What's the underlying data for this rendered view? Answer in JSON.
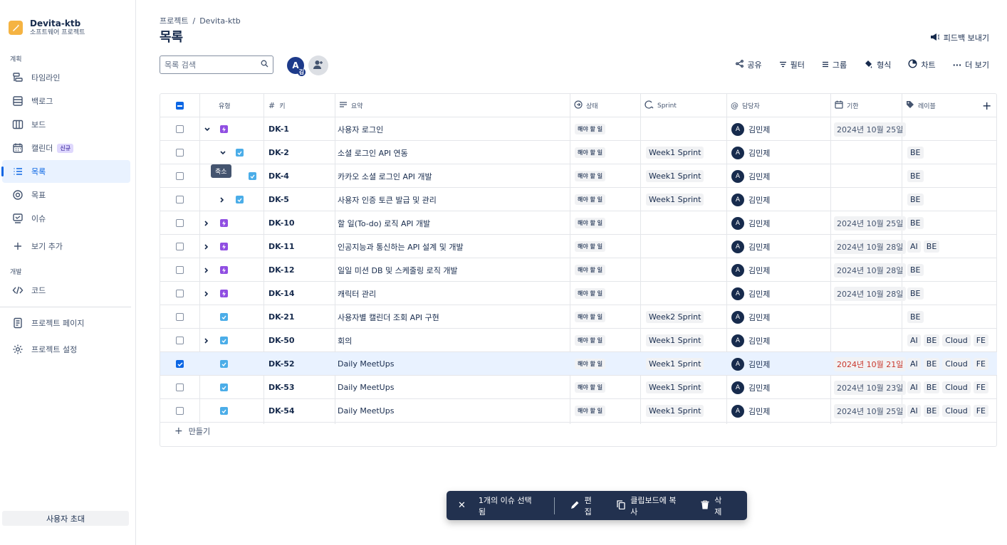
{
  "sidebar": {
    "project_name": "Devita-ktb",
    "project_type": "소프트웨어 프로젝트",
    "section_plan": "계획",
    "items": [
      {
        "label": "타임라인",
        "icon": "timeline-icon"
      },
      {
        "label": "백로그",
        "icon": "backlog-icon"
      },
      {
        "label": "보드",
        "icon": "board-icon"
      },
      {
        "label": "캘린더",
        "icon": "calendar-icon",
        "badge": "신규"
      },
      {
        "label": "목록",
        "icon": "list-icon",
        "active": true
      },
      {
        "label": "목표",
        "icon": "goal-icon"
      },
      {
        "label": "이슈",
        "icon": "issues-icon"
      },
      {
        "label": "보기 추가",
        "icon": "plus-icon"
      }
    ],
    "section_dev": "개발",
    "code": "코드",
    "project_page": "프로젝트 페이지",
    "project_settings": "프로젝트 설정",
    "invite": "사용자 초대"
  },
  "header": {
    "breadcrumb_root": "프로젝트",
    "breadcrumb_sep": "/",
    "breadcrumb_project": "Devita-ktb",
    "title": "목록",
    "feedback": "피드백 보내기",
    "search_placeholder": "목록 검색",
    "avatar_letter": "A",
    "avatar_sub": "김"
  },
  "toolbar": {
    "share": "공유",
    "filter": "필터",
    "group": "그룹",
    "format": "형식",
    "chart": "차트",
    "more": "더 보기"
  },
  "columns": {
    "type": "유형",
    "key": "키",
    "summary": "요약",
    "status": "상태",
    "sprint": "Sprint",
    "assignee": "담당자",
    "due": "기한",
    "labels": "레이블"
  },
  "tooltip": "축소",
  "rows": [
    {
      "checked": false,
      "expand": "v",
      "type": "epic",
      "indent": 0,
      "key": "DK-1",
      "summary": "사용자 로그인",
      "status": "해야 할 일",
      "sprint": "",
      "assignee": "김민제",
      "due": "2024년 10월 25일",
      "overdue": false,
      "labels": []
    },
    {
      "checked": false,
      "expand": "v",
      "type": "task",
      "indent": 1,
      "key": "DK-2",
      "summary": "소셜 로그인 API 연동",
      "status": "해야 할 일",
      "sprint": "Week1 Sprint",
      "assignee": "김민제",
      "due": "",
      "overdue": false,
      "labels": [
        "BE"
      ]
    },
    {
      "checked": false,
      "expand": "",
      "type": "task",
      "indent": 2,
      "key": "DK-4",
      "summary": "카카오 소셜 로그인 API 개발",
      "status": "해야 할 일",
      "sprint": "Week1 Sprint",
      "assignee": "김민제",
      "due": "",
      "overdue": false,
      "labels": [
        "BE"
      ]
    },
    {
      "checked": false,
      "expand": ">",
      "type": "task",
      "indent": 1,
      "key": "DK-5",
      "summary": "사용자 인증 토큰 발급 및 관리",
      "status": "해야 할 일",
      "sprint": "Week1 Sprint",
      "assignee": "김민제",
      "due": "",
      "overdue": false,
      "labels": [
        "BE"
      ]
    },
    {
      "checked": false,
      "expand": ">",
      "type": "epic",
      "indent": 0,
      "key": "DK-10",
      "summary": "할 일(To-do) 로직 API 개발",
      "status": "해야 할 일",
      "sprint": "",
      "assignee": "김민제",
      "due": "2024년 10월 25일",
      "overdue": false,
      "labels": [
        "BE"
      ]
    },
    {
      "checked": false,
      "expand": ">",
      "type": "epic",
      "indent": 0,
      "key": "DK-11",
      "summary": "인공지능과 통신하는 API 설계 및 개발",
      "status": "해야 할 일",
      "sprint": "",
      "assignee": "김민제",
      "due": "2024년 10월 28일",
      "overdue": false,
      "labels": [
        "AI",
        "BE"
      ]
    },
    {
      "checked": false,
      "expand": ">",
      "type": "epic",
      "indent": 0,
      "key": "DK-12",
      "summary": "일일 미션 DB 및 스케줄링 로직 개발",
      "status": "해야 할 일",
      "sprint": "",
      "assignee": "김민제",
      "due": "2024년 10월 28일",
      "overdue": false,
      "labels": [
        "BE"
      ]
    },
    {
      "checked": false,
      "expand": ">",
      "type": "epic",
      "indent": 0,
      "key": "DK-14",
      "summary": "캐릭터 관리",
      "status": "해야 할 일",
      "sprint": "",
      "assignee": "김민제",
      "due": "2024년 10월 28일",
      "overdue": false,
      "labels": [
        "BE"
      ]
    },
    {
      "checked": false,
      "expand": "",
      "type": "task",
      "indent": 0,
      "key": "DK-21",
      "summary": "사용자별 캘린더 조회 API 구현",
      "status": "해야 할 일",
      "sprint": "Week2 Sprint",
      "assignee": "김민제",
      "due": "",
      "overdue": false,
      "labels": [
        "BE"
      ]
    },
    {
      "checked": false,
      "expand": ">",
      "type": "task",
      "indent": 0,
      "key": "DK-50",
      "summary": "회의",
      "status": "해야 할 일",
      "sprint": "Week1 Sprint",
      "assignee": "김민제",
      "due": "",
      "overdue": false,
      "labels": [
        "AI",
        "BE",
        "Cloud",
        "FE"
      ]
    },
    {
      "checked": true,
      "expand": "",
      "type": "task",
      "indent": 0,
      "key": "DK-52",
      "summary": "Daily MeetUps",
      "status": "해야 할 일",
      "sprint": "Week1 Sprint",
      "assignee": "김민제",
      "due": "2024년 10월 21일",
      "overdue": true,
      "labels": [
        "AI",
        "BE",
        "Cloud",
        "FE"
      ]
    },
    {
      "checked": false,
      "expand": "",
      "type": "task",
      "indent": 0,
      "key": "DK-53",
      "summary": "Daily MeetUps",
      "status": "해야 할 일",
      "sprint": "Week1 Sprint",
      "assignee": "김민제",
      "due": "2024년 10월 23일",
      "overdue": false,
      "labels": [
        "AI",
        "BE",
        "Cloud",
        "FE"
      ]
    },
    {
      "checked": false,
      "expand": "",
      "type": "task",
      "indent": 0,
      "key": "DK-54",
      "summary": "Daily MeetUps",
      "status": "해야 할 일",
      "sprint": "Week1 Sprint",
      "assignee": "김민제",
      "due": "2024년 10월 25일",
      "overdue": false,
      "labels": [
        "AI",
        "BE",
        "Cloud",
        "FE"
      ]
    }
  ],
  "create": "만들기",
  "bulk": {
    "selected": "1개의 이슈 선택됨",
    "edit": "편집",
    "copy": "클립보드에 복사",
    "delete": "삭제"
  },
  "colors": {
    "accent": "#0c66e4",
    "epic": "#904ee2",
    "task": "#4bade8",
    "overdue": "#c9372c",
    "bulk_bg": "#22314f"
  }
}
